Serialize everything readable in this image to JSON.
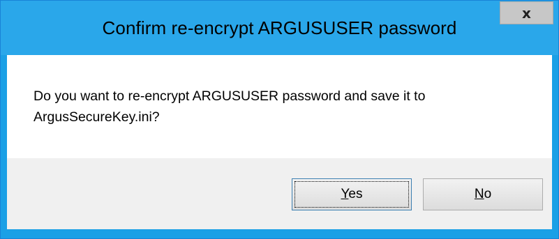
{
  "dialog": {
    "title": "Confirm re-encrypt ARGUSUSER password",
    "close_glyph": "x",
    "message": "Do you want to re-encrypt ARGUSUSER password and save it to ArgusSecureKey.ini?",
    "buttons": {
      "yes": {
        "mnemonic": "Y",
        "rest": "es"
      },
      "no": {
        "mnemonic": "N",
        "rest": "o"
      }
    },
    "default_button": "Yes"
  },
  "colors": {
    "titlebar": "#2aa7ea",
    "window_border": "#1883d7",
    "close_button_bg": "#c7c7c7",
    "button_bar_bg": "#f0f0f0",
    "default_button_border": "#3c7fb1"
  }
}
